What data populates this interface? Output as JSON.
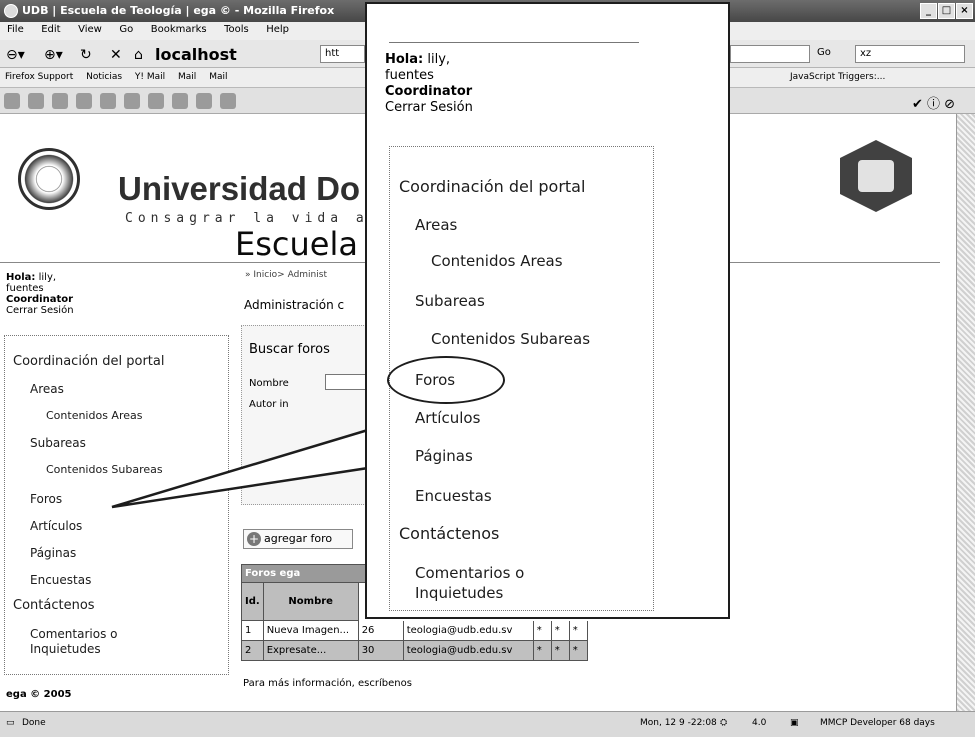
{
  "window": {
    "title": "UDB | Escuela de Teología | ega © - Mozilla Firefox",
    "buttons": [
      "_",
      "□",
      "×"
    ]
  },
  "menu": [
    "File",
    "Edit",
    "View",
    "Go",
    "Bookmarks",
    "Tools",
    "Help"
  ],
  "navigation": {
    "url": "localhost",
    "url_fragment": "htt",
    "go_label": "Go",
    "search_value": "xz"
  },
  "bookmarks": [
    "Firefox Support",
    "Noticias",
    "Y! Mail",
    "Mail",
    "Mail"
  ],
  "devbar": {
    "js_triggers": "JavaScript Triggers:..."
  },
  "header": {
    "university": "Universidad Do",
    "tagline": "Consagrar la vida a",
    "school": "Escuela d"
  },
  "user": {
    "greeting_label": "Hola:",
    "name": "lily,",
    "surname": "fuentes",
    "role": "Coordinator",
    "logout": "Cerrar Sesión"
  },
  "sidebar": {
    "items": [
      {
        "label": "Coordinación del portal",
        "level": 0
      },
      {
        "label": "Areas",
        "level": 1
      },
      {
        "label": "Contenidos Areas",
        "level": 2
      },
      {
        "label": "Subareas",
        "level": 1
      },
      {
        "label": "Contenidos Subareas",
        "level": 2
      },
      {
        "label": "Foros",
        "level": 1
      },
      {
        "label": "Artículos",
        "level": 1
      },
      {
        "label": "Páginas",
        "level": 1
      },
      {
        "label": "Encuestas",
        "level": 1
      },
      {
        "label": "Contáctenos",
        "level": 0
      },
      {
        "label": "Comentarios o",
        "level": 1
      },
      {
        "label": "Inquietudes",
        "level": 1
      }
    ]
  },
  "main": {
    "breadcrumb": "» Inicio> Administ",
    "title": "Administración c",
    "search_title": "Buscar foros",
    "search_name_label": "Nombre",
    "search_author_label": "Autor in",
    "add_label": "agregar foro",
    "table": {
      "caption": "Foros ega",
      "headers": [
        "Id.",
        "Nombre"
      ],
      "rows": [
        [
          "1",
          "Nueva Imagen...",
          "26",
          "teologia@udb.edu.sv",
          "*",
          "*",
          "*"
        ],
        [
          "2",
          "Expresate...",
          "30",
          "teologia@udb.edu.sv",
          "*",
          "*",
          "*"
        ]
      ]
    },
    "info": "Para más información, escríbenos"
  },
  "footer": {
    "copyright": "ega © 2005"
  },
  "status": {
    "left": "Done",
    "datetime": "Mon, 12 9 -22:08",
    "version": "4.0",
    "developer": "MMCP Developer 68 days"
  }
}
